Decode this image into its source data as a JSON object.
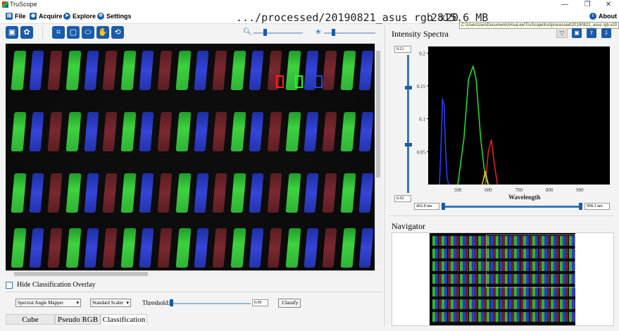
{
  "window": {
    "app_title": "TruScope"
  },
  "menu": {
    "file": "File",
    "acquire": "Acquire",
    "explore": "Explore",
    "settings": "Settings",
    "about": "About"
  },
  "header": {
    "path": ".../processed/20190821_asus rgb x20",
    "size": "2815.6 MB"
  },
  "toolbar": {
    "zoom_level": 0.2,
    "brightness_level": 0.15
  },
  "image_view": {
    "overlay_checkbox_label": "Hide Classification Overlay",
    "overlay_checked": false
  },
  "classification": {
    "method": "Spectral Angle Mapper",
    "scaler": "Standard Scaler",
    "threshold_label": "Threshold:",
    "threshold_value": "0.00",
    "classify_label": "Classify"
  },
  "tabs": [
    "Cube",
    "Pseudo RGB",
    "Classification"
  ],
  "active_tab": "Classification",
  "spectra": {
    "title": "Intensity Spectra",
    "tooltip_path": "C:\\Users\\zen\\Documents\\HsuLee\\TruScope\\hsi\\processed\\20190821_asus rgb x20",
    "y_max_spin": "0.21",
    "y_min_spin": "0.02",
    "wl_min_spin": "402.8 nm",
    "wl_max_spin": "998.3 nm"
  },
  "navigator": {
    "title": "Navigator"
  },
  "chart_data": {
    "type": "line",
    "xlabel": "Wavelength",
    "ylabel": "",
    "xlim": [
      402.8,
      998.3
    ],
    "ylim": [
      0.0,
      0.21
    ],
    "xticks": [
      "500",
      "600",
      "700",
      "800",
      "900"
    ],
    "yticks": [
      "0.2",
      "0.15",
      "0.1",
      "0.05"
    ],
    "grid": false,
    "series": [
      {
        "color": "#2a3cff",
        "x": [
          440,
          445,
          450,
          455,
          460,
          465,
          470
        ],
        "y": [
          0.0,
          0.06,
          0.13,
          0.12,
          0.05,
          0.01,
          0.0
        ]
      },
      {
        "color": "#22dd22",
        "x": [
          500,
          520,
          535,
          550,
          560,
          575,
          590,
          600
        ],
        "y": [
          0.0,
          0.07,
          0.16,
          0.18,
          0.16,
          0.07,
          0.01,
          0.0
        ]
      },
      {
        "color": "#e02020",
        "x": [
          590,
          600,
          610,
          620,
          630
        ],
        "y": [
          0.0,
          0.05,
          0.068,
          0.03,
          0.0
        ]
      },
      {
        "color": "#e0c020",
        "x": [
          580,
          590,
          600
        ],
        "y": [
          0.0,
          0.02,
          0.0
        ]
      }
    ]
  }
}
